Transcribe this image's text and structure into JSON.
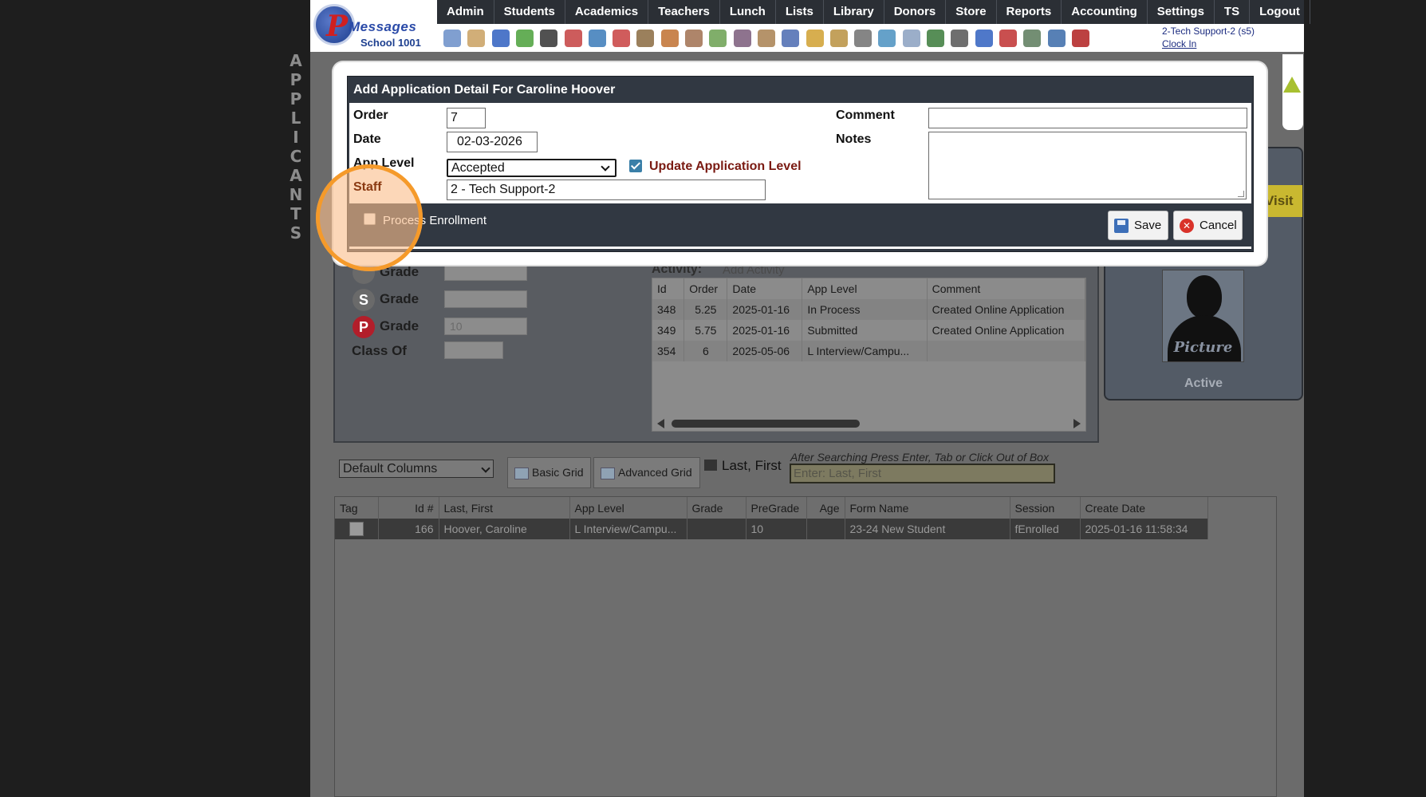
{
  "side_label": [
    "A",
    "P",
    "P",
    "L",
    "I",
    "C",
    "A",
    "N",
    "T",
    "S"
  ],
  "logo": {
    "letter": "P",
    "title": "Messages",
    "school": "School 1001"
  },
  "menu": [
    "Admin",
    "Students",
    "Academics",
    "Teachers",
    "Lunch",
    "Lists",
    "Library",
    "Donors",
    "Store",
    "Reports",
    "Accounting",
    "Settings",
    "TS",
    "Logout"
  ],
  "icons": [
    "search-icon",
    "grid-icon",
    "at-icon",
    "chat-icon",
    "phone-icon",
    "speaker-icon",
    "calculator-icon",
    "calendar-icon",
    "megaphone-icon",
    "person-icon",
    "teacher-icon",
    "eraser-icon",
    "users-icon",
    "lunch-icon",
    "book-icon",
    "bell-icon",
    "folder-arrow-icon",
    "staff-icon",
    "clock-icon",
    "list-icon",
    "ticket-icon",
    "printer-icon",
    "ap-icon",
    "pdf-icon",
    "money-icon",
    "help-icon",
    "power-icon"
  ],
  "icon_colors": [
    "#6a8ec8",
    "#c9a060",
    "#2f5fc0",
    "#4aa03a",
    "#333333",
    "#c44040",
    "#3a7ab8",
    "#c84040",
    "#8a6a40",
    "#c07030",
    "#a07050",
    "#6aa050",
    "#7a5a7a",
    "#a88050",
    "#4a6ab0",
    "#d0a030",
    "#b89040",
    "#707070",
    "#4a90c0",
    "#8aa0c0",
    "#3a7a3a",
    "#555555",
    "#3060c0",
    "#c03030",
    "#5a7a5a",
    "#3a6aa8",
    "#b02020"
  ],
  "user": {
    "name": "2-Tech Support-2 (s5)",
    "clock_in": "Clock In"
  },
  "background": {
    "grade_rows": [
      {
        "badge": "",
        "badge_color": "#6a6a6a",
        "label": "Grade",
        "value": ""
      },
      {
        "badge": "S",
        "badge_color": "#6a6a6a",
        "label": "Grade",
        "value": ""
      },
      {
        "badge": "P",
        "badge_color": "#b21e2a",
        "label": "Grade",
        "value": "10"
      }
    ],
    "class_of_label": "Class Of",
    "activity_label": "Activity:",
    "add_activity": "Add Activity",
    "activity_columns": [
      "Id",
      "Order",
      "Date",
      "App Level",
      "Comment"
    ],
    "activity_rows": [
      [
        "348",
        "5.25",
        "2025-01-16",
        "In Process",
        "Created Online Application"
      ],
      [
        "349",
        "5.75",
        "2025-01-16",
        "Submitted",
        "Created Online Application"
      ],
      [
        "354",
        "6",
        "2025-05-06",
        "L Interview/Campu...",
        ""
      ]
    ],
    "visit": "Visit",
    "picture_caption": "Picture",
    "status": "Active"
  },
  "toolbar": {
    "columns_select": "Default Columns",
    "basic_grid": "Basic Grid",
    "advanced_grid": "Advanced Grid",
    "sort_label": "Last, First",
    "hint": "After Searching Press Enter, Tab or Click Out of Box",
    "search_placeholder": "Enter: Last, First"
  },
  "grid": {
    "columns": [
      "Tag",
      "Id #",
      "Last, First",
      "App Level",
      "Grade",
      "PreGrade",
      "Age",
      "Form Name",
      "Session",
      "Create Date"
    ],
    "rows": [
      [
        "",
        "166",
        "Hoover, Caroline",
        "L Interview/Campu...",
        "",
        "10",
        "",
        "23-24 New Student",
        "fEnrolled",
        "2025-01-16 11:58:34"
      ]
    ]
  },
  "modal": {
    "title": "Add Application Detail For Caroline Hoover",
    "order_label": "Order",
    "order_value": "7",
    "date_label": "Date",
    "date_value": "02-03-2026",
    "app_level_label": "App Level",
    "app_level_value": "Accepted",
    "update_app_level": "Update Application Level",
    "staff_label": "Staff",
    "staff_value": "2 - Tech Support-2",
    "comment_label": "Comment",
    "comment_value": "",
    "notes_label": "Notes",
    "process_enrollment": "Process Enrollment",
    "save": "Save",
    "cancel": "Cancel"
  }
}
